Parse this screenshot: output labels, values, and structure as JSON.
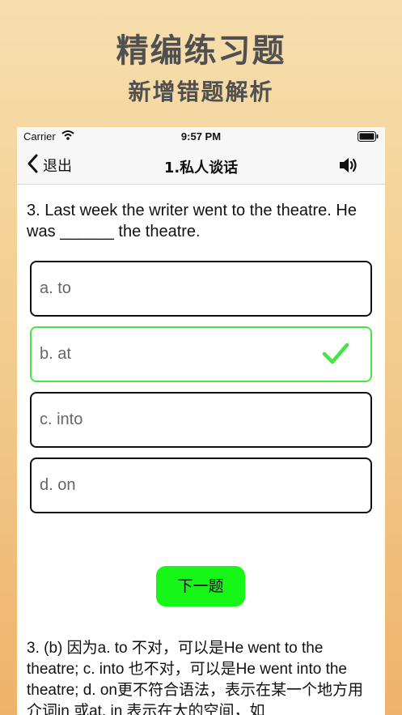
{
  "promo": {
    "title": "精编练习题",
    "subtitle": "新增错题解析"
  },
  "statusbar": {
    "carrier": "Carrier",
    "time": "9:57 PM"
  },
  "navbar": {
    "back_label": "退出",
    "title": "1.私人谈话"
  },
  "question": {
    "text": "3. Last week the writer went to the theatre. He was ______ the theatre."
  },
  "options": [
    {
      "label": "a. to",
      "state": "normal"
    },
    {
      "label": "b. at",
      "state": "correct"
    },
    {
      "label": "c. into",
      "state": "normal"
    },
    {
      "label": "d. on",
      "state": "normal"
    }
  ],
  "next_button": {
    "label": "下一题"
  },
  "explanation": {
    "text": "3. (b) 因为a. to 不对，可以是He went to the theatre; c. into 也不对，可以是He went into the theatre; d. on更不符合语法，表示在某一个地方用介词in 或at, in 表示在大的空间，如"
  },
  "colors": {
    "correct": "#44e544",
    "next_button_bg": "#17f717"
  }
}
